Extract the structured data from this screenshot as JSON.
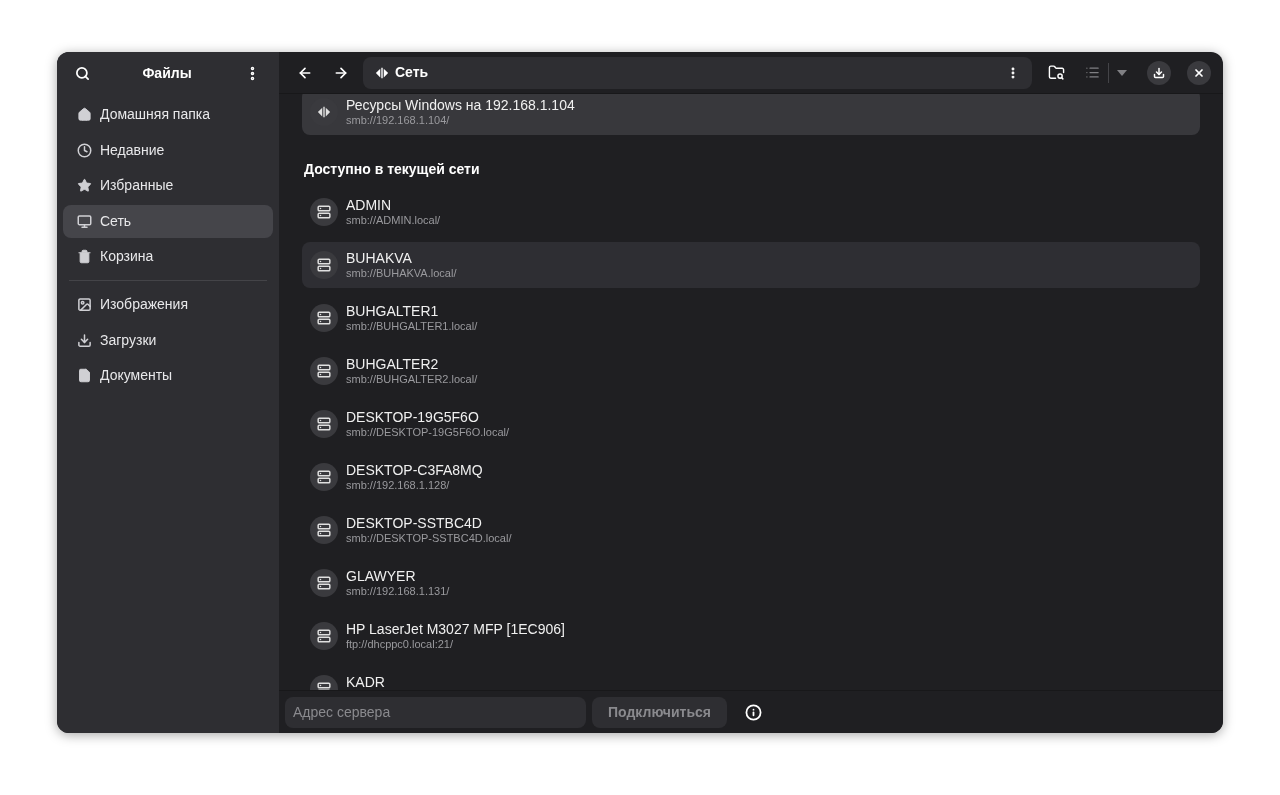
{
  "sidebar": {
    "title": "Файлы",
    "places": [
      {
        "label": "Домашняя папка",
        "selected": false
      },
      {
        "label": "Недавние",
        "selected": false
      },
      {
        "label": "Избранные",
        "selected": false
      },
      {
        "label": "Сеть",
        "selected": true
      },
      {
        "label": "Корзина",
        "selected": false
      }
    ],
    "bookmarks": [
      {
        "label": "Изображения",
        "selected": false
      },
      {
        "label": "Загрузки",
        "selected": false
      },
      {
        "label": "Документы",
        "selected": false
      }
    ]
  },
  "path_bar": {
    "location": "Сеть"
  },
  "connected": [
    {
      "name": "Ресурсы Windows на 192.168.1.104",
      "address": "smb://192.168.1.104/"
    }
  ],
  "available": {
    "heading": "Доступно в текущей сети",
    "items": [
      {
        "name": "ADMIN",
        "address": "smb://ADMIN.local/",
        "selected": false
      },
      {
        "name": "BUHAKVA",
        "address": "smb://BUHAKVA.local/",
        "selected": true
      },
      {
        "name": "BUHGALTER1",
        "address": "smb://BUHGALTER1.local/",
        "selected": false
      },
      {
        "name": "BUHGALTER2",
        "address": "smb://BUHGALTER2.local/",
        "selected": false
      },
      {
        "name": "DESKTOP-19G5F6O",
        "address": "smb://DESKTOP-19G5F6O.local/",
        "selected": false
      },
      {
        "name": "DESKTOP-C3FA8MQ",
        "address": "smb://192.168.1.128/",
        "selected": false
      },
      {
        "name": "DESKTOP-SSTBC4D",
        "address": "smb://DESKTOP-SSTBC4D.local/",
        "selected": false
      },
      {
        "name": "GLAWYER",
        "address": "smb://192.168.1.131/",
        "selected": false
      },
      {
        "name": "HP LaserJet M3027 MFP [1EC906]",
        "address": "ftp://dhcppc0.local:21/",
        "selected": false
      },
      {
        "name": "KADR",
        "selected": false
      }
    ]
  },
  "connect_bar": {
    "placeholder": "Адрес сервера",
    "button": "Подключиться"
  }
}
